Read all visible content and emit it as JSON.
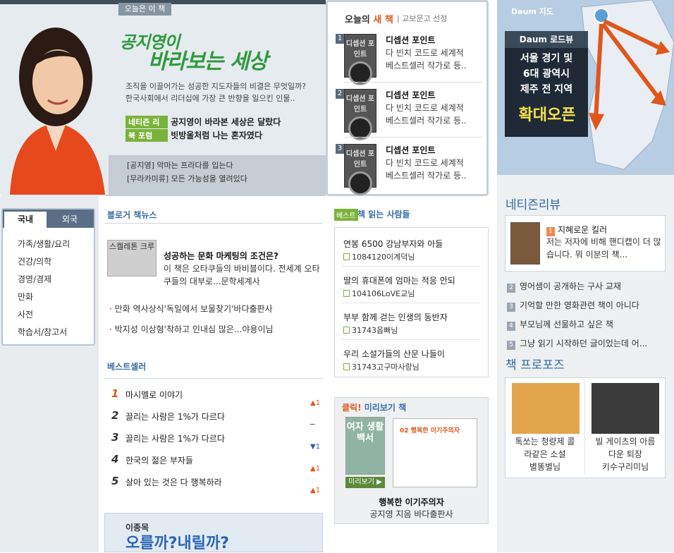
{
  "hero": {
    "tab": "오늘은 이 책",
    "headline1": "공지영이",
    "headline2": "바라보는 세상",
    "desc1": "조직을 이끌어가는 성공한 지도자들의 비결은 무엇일까?",
    "desc2": "한국사회에서 리더십에 가장 큰 반향을 일으킨 인물..",
    "tag1": "네티즌 리",
    "row1": "공지영이 바라본 세상은 달랐다",
    "tag2": "북 포럼",
    "row2": "빗방울처럼 나는 혼자였다",
    "row3": "[공지영] 악마는 프라다를 입는다",
    "row4": "[무라카미류] 모든 가능성을 열려있다"
  },
  "new_books": {
    "title_prefix": "오늘의 ",
    "title_accent": "새 책",
    "sub": "교보문고 선정",
    "items": [
      {
        "num": "1",
        "cover": "디셉션 포인트",
        "name": "디셉션 포인트",
        "desc1": "다 빈치 코드로 세계적",
        "desc2": "베스트셀러 작가로 등.."
      },
      {
        "num": "2",
        "cover": "디셉션 포인트",
        "name": "디셉션 포인트",
        "desc1": "다 빈치 코드로 세계적",
        "desc2": "베스트셀러 작가로 등.."
      },
      {
        "num": "3",
        "cover": "디셉션 포인트",
        "name": "디셉션 포인트",
        "desc1": "다 빈치 코드로 세계적",
        "desc2": "베스트셀러 작가로 등.."
      }
    ]
  },
  "map_ad": {
    "logo": "Daum 지도",
    "road": "Daum 로드뷰",
    "line1": "서울 경기 및",
    "line2": "6대 광역시",
    "line3": "제주 전 지역",
    "big": "확대오픈"
  },
  "categories": {
    "tab_domestic": "국내",
    "tab_foreign": "외국",
    "items": [
      "가족/생활/요리",
      "건강/의학",
      "경영/경제",
      "만화",
      "사전",
      "학습서/참고서"
    ]
  },
  "blog_news": {
    "title": "블로거 책뉴스",
    "img_text": "스켈레톤 크루",
    "headline": "성공하는 문화 마케팅의 조건은?",
    "desc": "이 책은 오타쿠들의 바비블이다. 전세계 오타쿠들의 대부로...문학세계사",
    "links": [
      "· 만화 역사상식'독일에서 보물찾기'바다출판사",
      "· 박지성 이상형'착하고 인내심 많은...야용이님"
    ]
  },
  "bestseller": {
    "title": "베스트셀러",
    "rows": [
      {
        "num": "1",
        "name": "마시멜로 이야기",
        "change": ""
      },
      {
        "num": "2",
        "name": "끌리는 사람은 1%가 다르다",
        "change": "▲1"
      },
      {
        "num": "3",
        "name": "끌리는 사람은 1%가 다르다",
        "change": "─"
      },
      {
        "num": "4",
        "name": "한국의 젊은 부자들",
        "change": "▼1"
      },
      {
        "num": "5",
        "name": "살아 있는 것은 다 행복하라",
        "change": "▲1"
      }
    ],
    "last_change": "▲1",
    "banner1": "이종목",
    "banner2": "오를까?내릴까?"
  },
  "readers": {
    "badge": "베스트",
    "title": "책 읽는 사람들",
    "items": [
      {
        "q": "연봉 6500 강남부자와 아들",
        "u": "1084120이계덕님"
      },
      {
        "q": "딸의 휴대폰에 엄마는 적응 안되",
        "u": "104106LoVE교님"
      },
      {
        "q": "부부 함께 걷는 인생의 동반자",
        "u": "31743옵빠님"
      },
      {
        "q": "우리 소설가들의 산문 나들이",
        "u": "31743고구마사랑님"
      }
    ]
  },
  "preview": {
    "title_accent": "클릭!",
    "title": " 미리보기 책",
    "cover": "여자 생활 백서",
    "btn": "미리보기 ▶",
    "page_head": "02 행복한 이기주의자",
    "name": "행복한 이기주의자",
    "author": "공지영 지음 바다출판사"
  },
  "netizen_review": {
    "title": "네티즌리뷰",
    "top_num": "1",
    "top_name": "지혜로운 킬러",
    "top_desc": "저는 저자에 비해 핸디캡이 더 많습니다. 뭐 이분의 책...",
    "items": [
      {
        "num": "2",
        "text": "영어샘이 공개하는 구사 교재"
      },
      {
        "num": "3",
        "text": "기억할 만한 영화관련 책이 아니다"
      },
      {
        "num": "4",
        "text": "부모님께 선물하고 싶은 책"
      },
      {
        "num": "5",
        "text": "그냥 읽기 시작하던 글이었는데 어..."
      }
    ]
  },
  "proposal": {
    "title": "책 프로포즈",
    "item1": {
      "line1": "톡쏘는 청량제 콜",
      "line2": "라같은 소설",
      "line3": "별똥별님"
    },
    "item2": {
      "line1": "빌 게이츠의 아름",
      "line2": "다운 퇴장",
      "line3": "키수구리미님"
    }
  },
  "colors": {
    "accent_green": "#2f9a3e",
    "accent_orange": "#e0561b",
    "link_blue": "#3a6ea5"
  }
}
